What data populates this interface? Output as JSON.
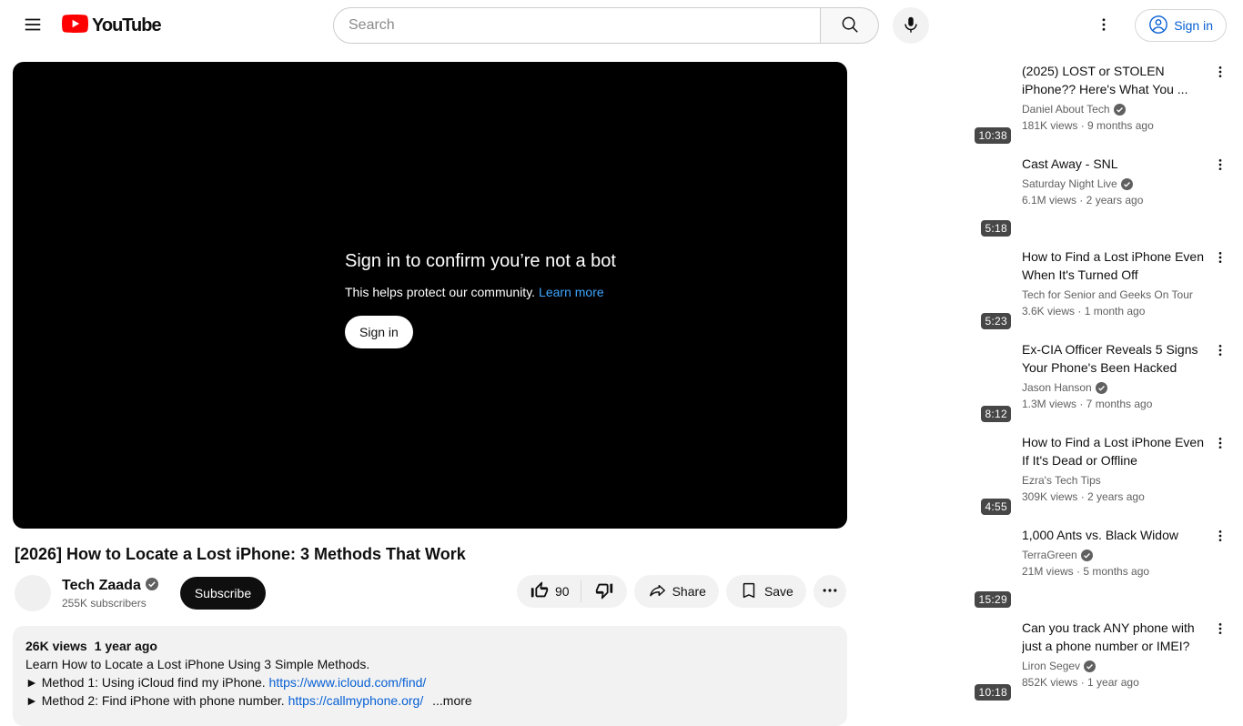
{
  "header": {
    "brand": "YouTube",
    "search_placeholder": "Search",
    "sign_in": "Sign in"
  },
  "player": {
    "heading": "Sign in to confirm you’re not a bot",
    "body": "This helps protect our community.",
    "learn_more": "Learn more",
    "sign_in": "Sign in"
  },
  "video": {
    "title": "[2026] How to Locate a Lost iPhone: 3 Methods That Work",
    "channel_name": "Tech Zaada",
    "channel_subs": "255K subscribers",
    "subscribe": "Subscribe",
    "like_count": "90",
    "share": "Share",
    "save": "Save"
  },
  "description": {
    "views": "26K views",
    "date": "1 year ago",
    "line1": "Learn How to Locate a Lost iPhone Using 3 Simple Methods.",
    "line2_text": "► Method 1: Using iCloud find my iPhone.",
    "line2_link": "https://www.icloud.com/find/",
    "line3_text": "► Method 2: Find iPhone with phone number.",
    "line3_link": "https://callmyphone.org/",
    "more": "...more"
  },
  "sidebar": {
    "items": [
      {
        "title": "(2025) LOST or STOLEN iPhone?? Here's What You ...",
        "channel": "Daniel About Tech",
        "verified": true,
        "meta": "181K views · 9 months ago",
        "duration": "10:38"
      },
      {
        "title": "Cast Away - SNL",
        "channel": "Saturday Night Live",
        "verified": true,
        "meta": "6.1M views · 2 years ago",
        "duration": "5:18"
      },
      {
        "title": "How to Find a Lost iPhone Even When It's Turned Off",
        "channel": "Tech for Senior and Geeks On Tour",
        "verified": false,
        "meta": "3.6K views · 1 month ago",
        "duration": "5:23"
      },
      {
        "title": "Ex-CIA Officer Reveals 5 Signs Your Phone's Been Hacked",
        "channel": "Jason Hanson",
        "verified": true,
        "meta": "1.3M views · 7 months ago",
        "duration": "8:12"
      },
      {
        "title": "How to Find a Lost iPhone Even If It's Dead or Offline",
        "channel": "Ezra's Tech Tips",
        "verified": false,
        "meta": "309K views · 2 years ago",
        "duration": "4:55"
      },
      {
        "title": "1,000 Ants vs. Black Widow",
        "channel": "TerraGreen",
        "verified": true,
        "meta": "21M views · 5 months ago",
        "duration": "15:29"
      },
      {
        "title": "Can you track ANY phone with just a phone number or IMEI?",
        "channel": "Liron Segev",
        "verified": true,
        "meta": "852K views · 1 year ago",
        "duration": "10:18"
      }
    ]
  },
  "colors": {
    "brand_red": "#ff0000",
    "link_blue": "#065fd4",
    "player_link_blue": "#3ea6ff",
    "text_primary": "#0f0f0f",
    "text_secondary": "#606060",
    "chip_bg": "#f2f2f2"
  }
}
